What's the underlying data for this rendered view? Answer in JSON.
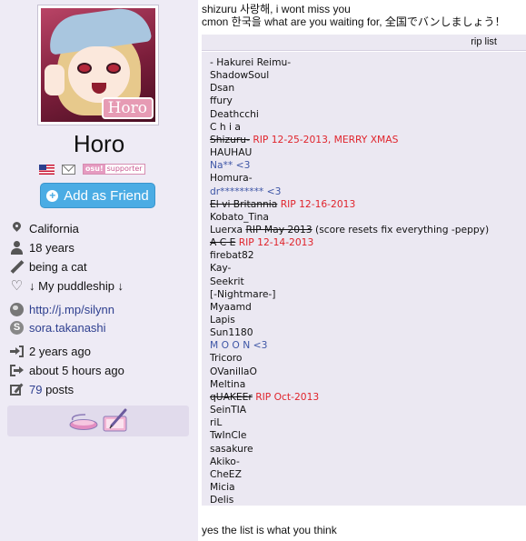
{
  "profile": {
    "avatar_label": "Horo",
    "username": "Horo",
    "badges": {
      "flag_icon": "us-flag-icon",
      "mail_icon": "mail-icon",
      "supporter_prefix": "osu!",
      "supporter_label": "supporter"
    },
    "add_friend_label": "Add as Friend",
    "info": {
      "location": "California",
      "age": "18 years",
      "occupation": "being a cat",
      "interests": "↓ My puddleship ↓",
      "website": "http://j.mp/silynn",
      "skype": "sora.takanashi",
      "joined": "2 years ago",
      "last_active": "about 5 hours ago",
      "posts_count": "79",
      "posts_suffix": " posts"
    },
    "playstyle": [
      "mouse-icon",
      "tablet-icon"
    ]
  },
  "content": {
    "line1": "shizuru 사랑해, i wont miss you",
    "line2": "cmon 한국을 what are you waiting for, 全国でバンしましょう！",
    "tab_label": "rip list",
    "list": [
      {
        "name": "- Hakurei Reimu-"
      },
      {
        "name": "ShadowSoul"
      },
      {
        "name": "Dsan"
      },
      {
        "name": "ffury"
      },
      {
        "name": "Deathcchi"
      },
      {
        "name": "C h i a"
      },
      {
        "name": "Shizuru-",
        "struck": true,
        "rip": " RIP 12-25-2013, MERRY XMAS"
      },
      {
        "name": "HAUHAU"
      },
      {
        "name": "Na** <3",
        "blue": true
      },
      {
        "name": "Homura-"
      },
      {
        "name": "dr********* <3",
        "blue": true
      },
      {
        "name": "El vi Britannia",
        "struck": true,
        "rip": " RIP 12-16-2013"
      },
      {
        "name": "Kobato_Tina"
      },
      {
        "name": "Luerxa ",
        "struck_part": "RIP May 2013",
        "note": " (score resets fix everything -peppy)"
      },
      {
        "name": "A C E",
        "struck": true,
        "rip": " RIP 12-14-2013"
      },
      {
        "name": "firebat82"
      },
      {
        "name": "Kay-"
      },
      {
        "name": "Seekrit"
      },
      {
        "name": "[-Nightmare-]"
      },
      {
        "name": "Myaamd"
      },
      {
        "name": "Lapis"
      },
      {
        "name": "Sun1180"
      },
      {
        "name": "M O O N <3",
        "blue": true
      },
      {
        "name": "Tricoro"
      },
      {
        "name": "OVanillaO"
      },
      {
        "name": "Meltina"
      },
      {
        "name": "qUAKEEr",
        "struck": true,
        "rip": " RIP Oct-2013"
      },
      {
        "name": "SeinTIA"
      },
      {
        "name": "riL"
      },
      {
        "name": "TwInCle"
      },
      {
        "name": "sasakure"
      },
      {
        "name": "Akiko-"
      },
      {
        "name": "CheEZ"
      },
      {
        "name": "Micia"
      },
      {
        "name": "Delis"
      }
    ],
    "footer": "yes the list is what you think"
  },
  "colors": {
    "sidebar_bg": "#eeebf5",
    "panel_bg": "#ebe8f2",
    "friend_button": "#4bace4",
    "rip_red": "#e0242c",
    "link_blue": "#2e3f8f",
    "heart_blue": "#3e56a6"
  }
}
